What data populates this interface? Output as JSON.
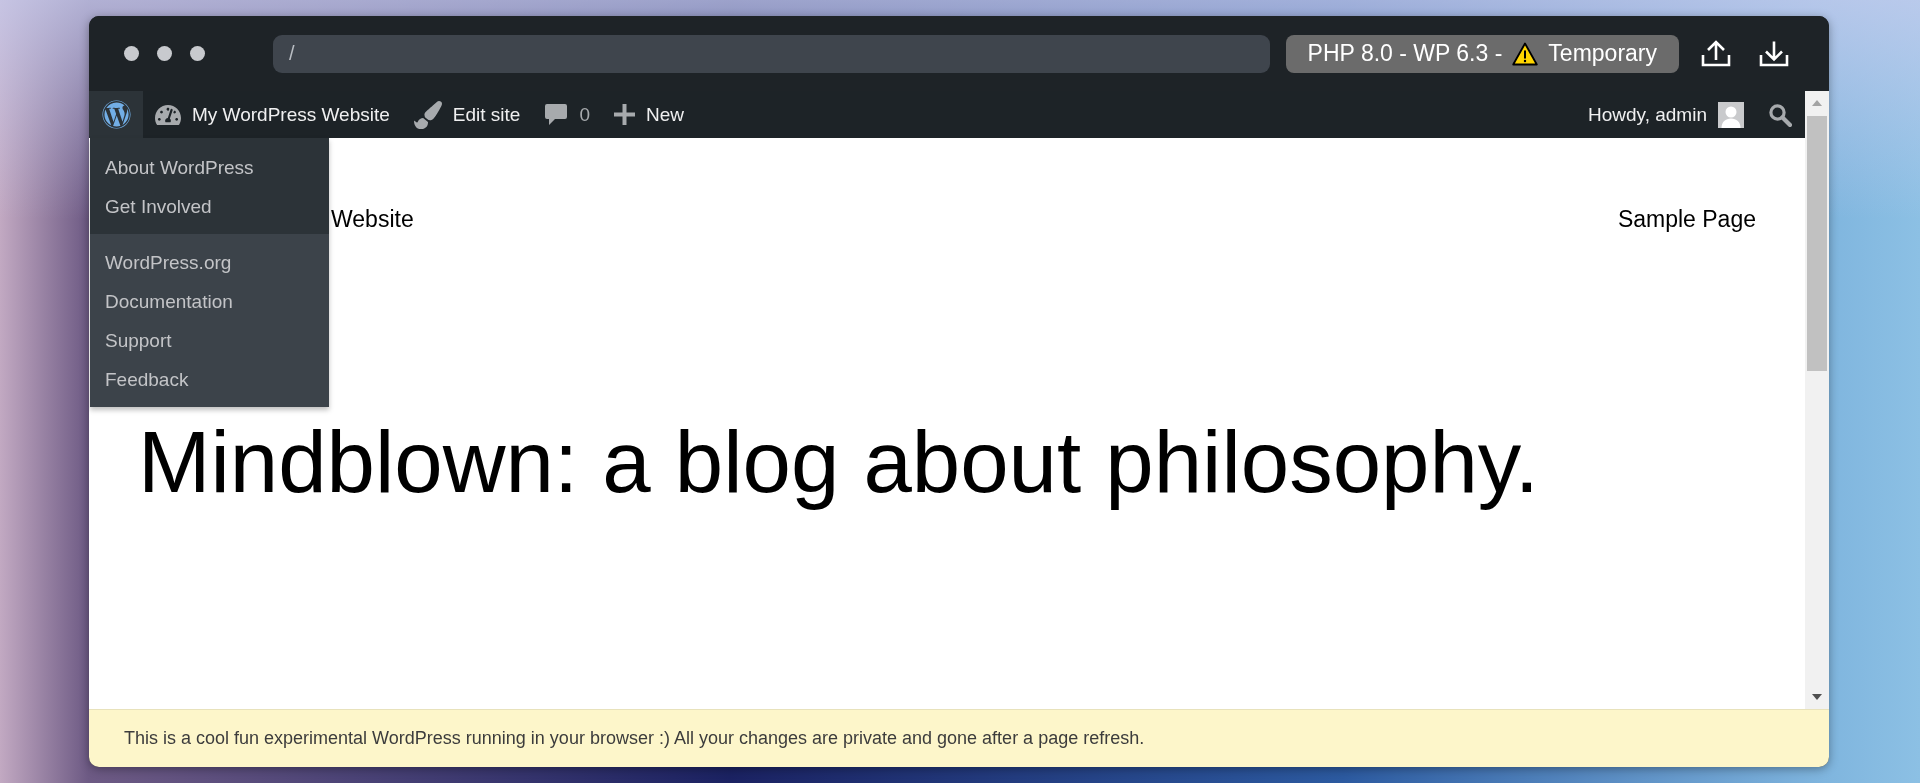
{
  "browser": {
    "address": "/",
    "badge": {
      "label": "PHP 8.0 - WP 6.3 -",
      "status": "Temporary"
    }
  },
  "admin_bar": {
    "logo": {
      "expanded": true
    },
    "items": [
      {
        "kind": "dashboard",
        "label": "My WordPress Website"
      },
      {
        "kind": "edit",
        "label": "Edit site"
      },
      {
        "kind": "comments",
        "label": "0"
      },
      {
        "kind": "new",
        "label": "New"
      }
    ],
    "account": {
      "label": "Howdy, admin"
    }
  },
  "menu": {
    "groups": [
      {
        "kind": "primary",
        "items": [
          "About WordPress",
          "Get Involved"
        ]
      },
      {
        "kind": "secondary",
        "items": [
          "WordPress.org",
          "Documentation",
          "Support",
          "Feedback"
        ]
      }
    ]
  },
  "site": {
    "title": "Website",
    "nav": [
      "Sample Page"
    ],
    "heading": "Mindblown: a blog about philosophy."
  },
  "notice": "This is a cool fun experimental WordPress running in your browser :) All your changes are private and gone after a page refresh."
}
